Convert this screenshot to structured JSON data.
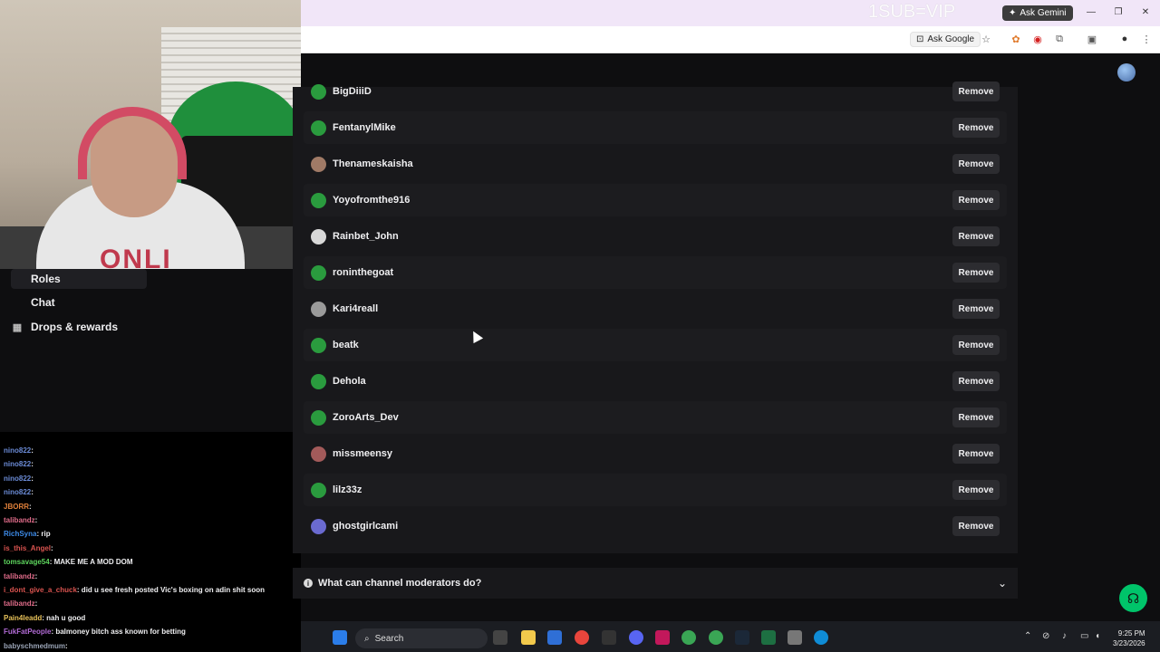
{
  "overlay": {
    "sub_vip": "1SUB=VIP",
    "webcam_shirt_text": "ONLI"
  },
  "browser": {
    "ask_gemini_label": "Ask Gemini",
    "ask_google_label": "Ask Google"
  },
  "leftnav": {
    "items": [
      {
        "label": "Roles",
        "icon": ""
      },
      {
        "label": "Chat",
        "icon": ""
      },
      {
        "label": "Drops & rewards",
        "icon": "gift-icon"
      }
    ]
  },
  "chat": {
    "lines": [
      {
        "user": "nino822",
        "text": ":",
        "color": "#6b8bd6"
      },
      {
        "user": "nino822",
        "text": ":",
        "color": "#6b8bd6"
      },
      {
        "user": "nino822",
        "text": ":",
        "color": "#6b8bd6"
      },
      {
        "user": "nino822",
        "text": ":",
        "color": "#6b8bd6"
      },
      {
        "user": "JBORR",
        "text": ":",
        "color": "#e0803a"
      },
      {
        "user": "talibandz",
        "text": ":",
        "color": "#e06c8a"
      },
      {
        "user": "RichSyna",
        "text": ": rip",
        "color": "#3d8be8"
      },
      {
        "user": "is_this_Angel",
        "text": ":",
        "color": "#d9534f"
      },
      {
        "user": "tomsavage54",
        "text": ": MAKE ME A MOD DOM",
        "color": "#5dd55d"
      },
      {
        "user": "talibandz",
        "text": ":",
        "color": "#e06c8a"
      },
      {
        "user": "i_dont_give_a_chuck",
        "text": ": did u see fresh posted Vic's boxing on adin shit soon",
        "color": "#d9534f"
      },
      {
        "user": "talibandz",
        "text": ":",
        "color": "#e06c8a"
      },
      {
        "user": "Pain4leadd",
        "text": ": nah u good",
        "color": "#e8c25a"
      },
      {
        "user": "FukFatPeople",
        "text": ": balmoney bitch ass known for betting",
        "color": "#b26bd6"
      },
      {
        "user": "babyschmedmum",
        "text": ":",
        "color": "#9aa4b6"
      }
    ]
  },
  "moderators": [
    {
      "name": "BigDiiiD",
      "avatar_color": "#2a9b3e"
    },
    {
      "name": "FentanylMike",
      "avatar_color": "#2a9b3e"
    },
    {
      "name": "Thenameskaisha",
      "avatar_color": "#a07a66"
    },
    {
      "name": "Yoyofromthe916",
      "avatar_color": "#2a9b3e"
    },
    {
      "name": "Rainbet_John",
      "avatar_color": "#d8d8d8"
    },
    {
      "name": "roninthegoat",
      "avatar_color": "#2a9b3e"
    },
    {
      "name": "Kari4reall",
      "avatar_color": "#9a9a9a"
    },
    {
      "name": "beatk",
      "avatar_color": "#2a9b3e"
    },
    {
      "name": "Dehola",
      "avatar_color": "#2a9b3e"
    },
    {
      "name": "ZoroArts_Dev",
      "avatar_color": "#2a9b3e"
    },
    {
      "name": "missmeensy",
      "avatar_color": "#a35a5a"
    },
    {
      "name": "lilz33z",
      "avatar_color": "#2a9b3e"
    },
    {
      "name": "ghostgirlcami",
      "avatar_color": "#6a6ad0"
    }
  ],
  "remove_label": "Remove",
  "faq": {
    "question": "What can channel moderators do?"
  },
  "taskbar": {
    "search_label": "Search",
    "time": "9:25 PM",
    "date": "3/23/2026"
  }
}
